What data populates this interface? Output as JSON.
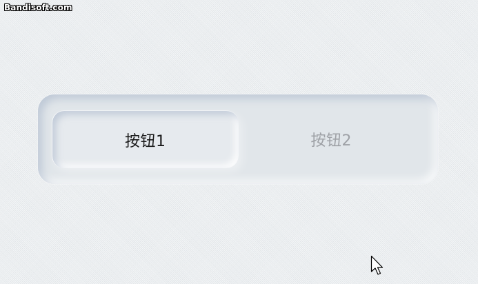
{
  "watermark": "Bandisoft.com",
  "segmented_control": {
    "buttons": [
      {
        "label": "按钮1",
        "active": true
      },
      {
        "label": "按钮2",
        "active": false
      }
    ]
  },
  "colors": {
    "background": "#e9edf0",
    "active_text": "#1a1a1a",
    "inactive_text": "#9ea1a6"
  },
  "icons": {
    "cursor": "arrow-cursor-icon"
  }
}
